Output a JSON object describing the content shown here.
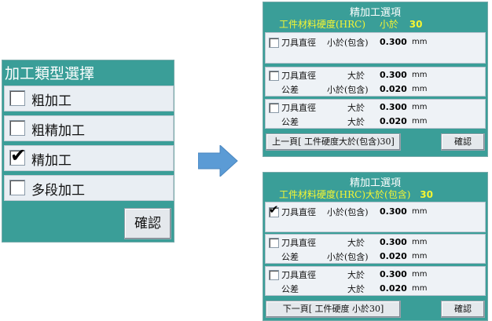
{
  "left_panel": {
    "title": "加工類型選擇",
    "options": [
      {
        "label": "粗加工",
        "checked": false
      },
      {
        "label": "粗精加工",
        "checked": false
      },
      {
        "label": "精加工",
        "checked": true
      },
      {
        "label": "多段加工",
        "checked": false
      }
    ],
    "confirm_label": "確認"
  },
  "colors": {
    "panel_bg": "#3a9e98",
    "highlight_text": "#f5f532",
    "arrow": "#5b9bd5"
  },
  "panel_top": {
    "title": "精加工選項",
    "hardness_label": "工件材料硬度(HRC)",
    "hardness_cond": "小於",
    "hardness_value": "30",
    "group1": {
      "checked": false,
      "name": "刀具直徑",
      "cond": "小於(包含)",
      "value": "0.300",
      "unit": "mm"
    },
    "group2": {
      "checked": false,
      "name": "刀具直徑",
      "cond": "大於",
      "value": "0.300",
      "unit": "mm",
      "tol_name": "公差",
      "tol_cond": "小於(包含)",
      "tol_value": "0.020",
      "tol_unit": "mm"
    },
    "group3": {
      "checked": false,
      "name": "刀具直徑",
      "cond": "大於",
      "value": "0.300",
      "unit": "mm",
      "tol_name": "公差",
      "tol_cond": "大於",
      "tol_value": "0.020",
      "tol_unit": "mm"
    },
    "nav_label": "上一頁[ 工件硬度大於(包含)30]",
    "confirm_label": "確認"
  },
  "panel_bottom": {
    "title": "精加工選項",
    "hardness_label": "工件材料硬度(HRC)大於(包含)",
    "hardness_value": "30",
    "group1": {
      "checked": true,
      "name": "刀具直徑",
      "cond": "小於(包含)",
      "value": "0.300",
      "unit": "mm"
    },
    "group2": {
      "checked": false,
      "name": "刀具直徑",
      "cond": "大於",
      "value": "0.300",
      "unit": "mm",
      "tol_name": "公差",
      "tol_cond": "小於(包含)",
      "tol_value": "0.020",
      "tol_unit": "mm"
    },
    "group3": {
      "checked": false,
      "name": "刀具直徑",
      "cond": "大於",
      "value": "0.300",
      "unit": "mm",
      "tol_name": "公差",
      "tol_cond": "大於",
      "tol_value": "0.020",
      "tol_unit": "mm"
    },
    "nav_label": "下一頁[ 工件硬度  小於30]",
    "confirm_label": "確認"
  }
}
